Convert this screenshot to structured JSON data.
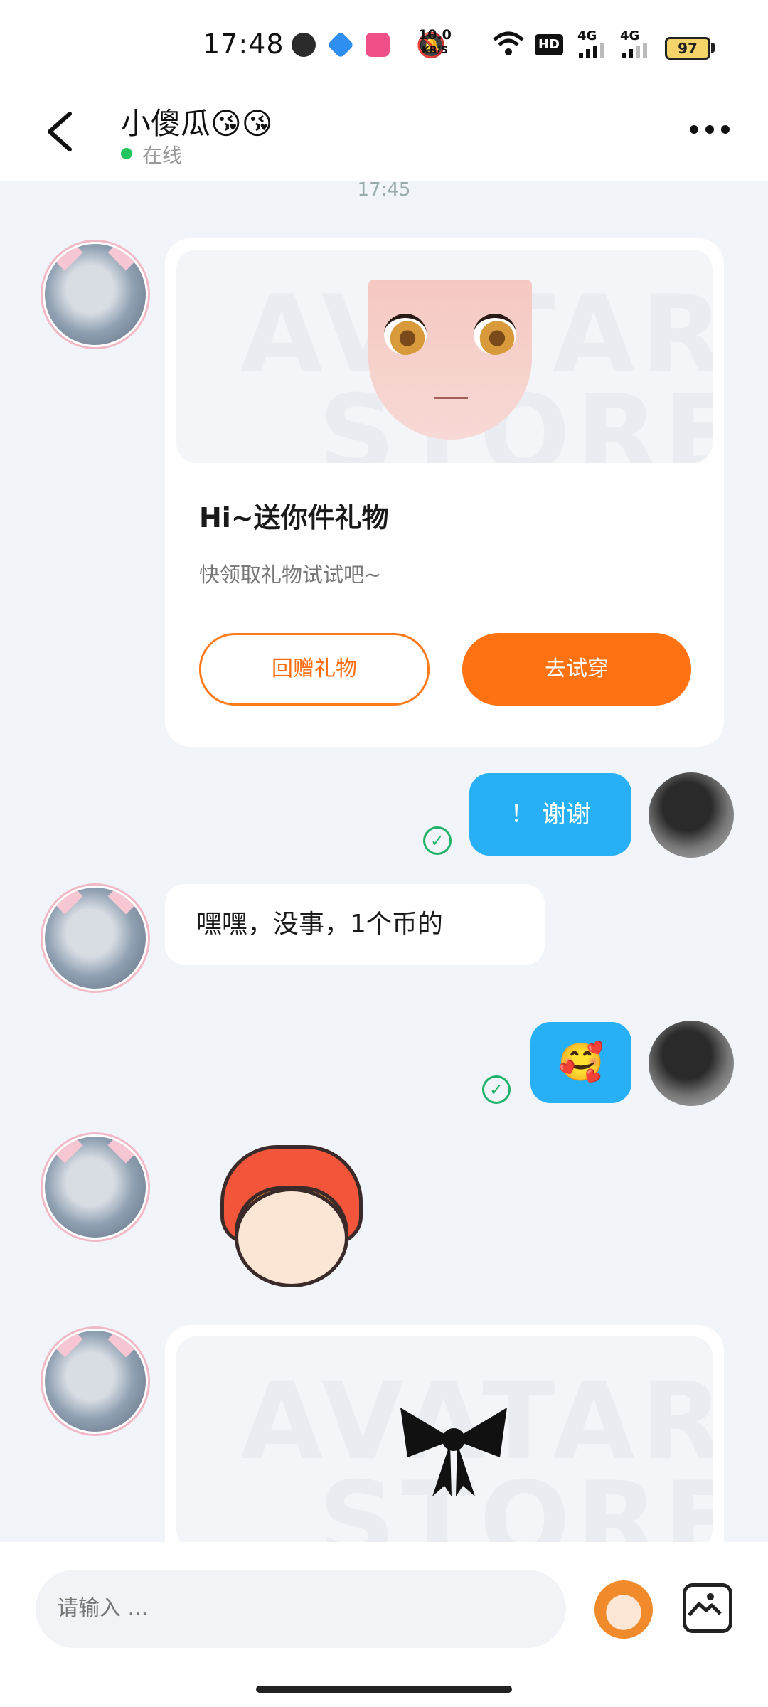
{
  "status_bar": {
    "time": "17:48",
    "net_speed": "10.0",
    "net_unit": "KB/S",
    "hd_label": "HD",
    "signal_label_1": "4G",
    "signal_label_2": "4G",
    "battery": "97"
  },
  "header": {
    "title": "小傻瓜😘😘",
    "status": "在线"
  },
  "timestamp": "17:45",
  "messages": [
    {
      "side": "left",
      "type": "gift_card",
      "banner_watermark_1": "AVATAR",
      "banner_watermark_2": "STORE",
      "title": "Hi~送你件礼物",
      "subtitle": "快领取礼物试试吧~",
      "button_return": "回赠礼物",
      "button_try": "去试穿"
    },
    {
      "side": "right",
      "type": "text",
      "text": "！ 谢谢",
      "read": true
    },
    {
      "side": "left",
      "type": "text",
      "text": "嘿嘿，没事，1个币的"
    },
    {
      "side": "right",
      "type": "emoji",
      "text": "🥰",
      "read": true
    },
    {
      "side": "left",
      "type": "sticker"
    },
    {
      "side": "left",
      "type": "gift_card_partial",
      "banner_watermark_1": "AVATAR",
      "banner_watermark_2": "STORE"
    }
  ],
  "input": {
    "placeholder": "请输入 ..."
  },
  "colors": {
    "accent_orange": "#ff7212",
    "bubble_blue": "#27b0f5",
    "online_green": "#23c55e",
    "read_green": "#1fb36a"
  }
}
